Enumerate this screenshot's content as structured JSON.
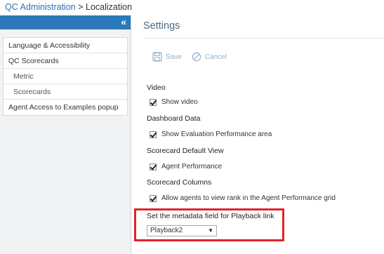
{
  "breadcrumb": {
    "parent": "QC Administration",
    "separator": ">",
    "current": "Localization"
  },
  "sidebar": {
    "collapse_icon": "«",
    "items": [
      {
        "label": "Language & Accessibility"
      },
      {
        "label": "QC Scorecards"
      },
      {
        "label": "Metric"
      },
      {
        "label": "Scorecards"
      },
      {
        "label": "Agent Access to Examples popup"
      }
    ]
  },
  "main": {
    "title": "Settings",
    "toolbar": {
      "save_label": "Save",
      "cancel_label": "Cancel"
    },
    "sections": {
      "video": {
        "title": "Video",
        "option": "Show video",
        "checked": true
      },
      "dashboard": {
        "title": "Dashboard Data",
        "option": "Show Evaluation Performance area",
        "checked": true
      },
      "default_view": {
        "title": "Scorecard Default View",
        "option": "Agent Performance",
        "checked": true
      },
      "columns": {
        "title": "Scorecard Columns",
        "option": "Allow agents to view rank in the Agent Performance grid",
        "checked": true
      }
    },
    "playback": {
      "label": "Set the metadata field for Playback link",
      "selected": "Playback2"
    }
  },
  "colors": {
    "brand_blue": "#2b79b8",
    "link": "#2a73b7",
    "highlight": "#e0232b"
  }
}
